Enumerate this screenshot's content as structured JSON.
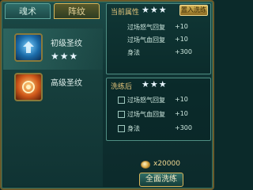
{
  "tabs": [
    {
      "label": "魂术",
      "active": false
    },
    {
      "label": "阵纹",
      "active": true
    }
  ],
  "items": [
    {
      "name": "初级圣纹",
      "stars": "★★★",
      "icon": "blue-rune-icon"
    },
    {
      "name": "高级圣纹",
      "stars": "",
      "icon": "orange-rune-icon"
    }
  ],
  "current": {
    "title": "当前属性",
    "stars": "★★★",
    "replace_label": "置入洗练",
    "stats": [
      {
        "name": "过场怒气回复",
        "value": "+10"
      },
      {
        "name": "过场气血回复",
        "value": "+10"
      },
      {
        "name": "身法",
        "value": "+300"
      }
    ]
  },
  "after": {
    "title": "洗练后",
    "stars": "★★★",
    "stats": [
      {
        "name": "过场怒气回复",
        "value": "+10"
      },
      {
        "name": "过场气血回复",
        "value": "+10"
      },
      {
        "name": "身法",
        "value": "+300"
      }
    ]
  },
  "cost": {
    "value": "x20000",
    "icon": "coin-icon"
  },
  "action": {
    "wash_all_label": "全面洗练"
  },
  "colors": {
    "gold": "#d8b65a",
    "teal": "#1c4d4a",
    "cream": "#f0d890"
  }
}
